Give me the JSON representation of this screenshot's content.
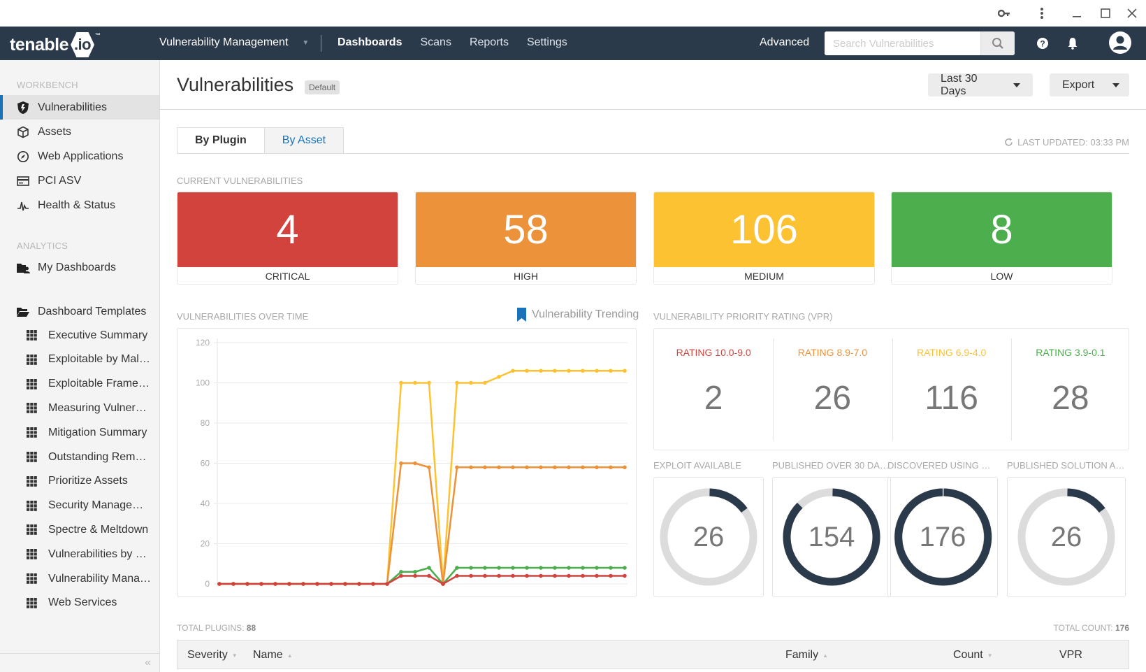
{
  "window": {
    "controls": [
      "key-icon",
      "more-icon",
      "minimize-icon",
      "maximize-icon",
      "close-icon"
    ]
  },
  "topnav": {
    "logo_text": "tenable",
    "logo_suffix": ".io",
    "logo_tm": "™",
    "product": "Vulnerability Management",
    "links": [
      {
        "label": "Dashboards",
        "active": true
      },
      {
        "label": "Scans",
        "active": false
      },
      {
        "label": "Reports",
        "active": false
      },
      {
        "label": "Settings",
        "active": false
      }
    ],
    "advanced": "Advanced",
    "search_placeholder": "Search Vulnerabilities",
    "search_value": ""
  },
  "sidebar": {
    "workbench_label": "WORKBENCH",
    "workbench_items": [
      {
        "label": "Vulnerabilities",
        "icon": "shield-icon",
        "active": true
      },
      {
        "label": "Assets",
        "icon": "cube-icon"
      },
      {
        "label": "Web Applications",
        "icon": "compass-icon"
      },
      {
        "label": "PCI ASV",
        "icon": "credit-card-icon"
      },
      {
        "label": "Health & Status",
        "icon": "pulse-icon"
      }
    ],
    "analytics_label": "ANALYTICS",
    "my_dashboards": "My Dashboards",
    "templates_label": "Dashboard Templates",
    "templates": [
      "Executive Summary",
      "Exploitable by Mal…",
      "Exploitable Frame…",
      "Measuring Vulner…",
      "Mitigation Summary",
      "Outstanding Rem…",
      "Prioritize Assets",
      "Security Manage…",
      "Spectre & Meltdown",
      "Vulnerabilities by …",
      "Vulnerability Mana…",
      "Web Services"
    ],
    "collapse": "«"
  },
  "header": {
    "title": "Vulnerabilities",
    "badge": "Default",
    "date_range": "Last 30 Days",
    "export": "Export"
  },
  "tabs": [
    {
      "label": "By Plugin",
      "active": true
    },
    {
      "label": "By Asset",
      "active": false
    }
  ],
  "last_updated": "LAST UPDATED: 03:33 PM",
  "current": {
    "label": "CURRENT VULNERABILITIES",
    "cards": [
      {
        "value": "4",
        "label": "CRITICAL",
        "color": "#d3433e"
      },
      {
        "value": "58",
        "label": "HIGH",
        "color": "#ec923a"
      },
      {
        "value": "106",
        "label": "MEDIUM",
        "color": "#fcc232"
      },
      {
        "value": "8",
        "label": "LOW",
        "color": "#4cae4c"
      }
    ]
  },
  "over_time": {
    "label": "VULNERABILITIES OVER TIME",
    "link": "Vulnerability Trending"
  },
  "chart_data": {
    "type": "line",
    "title": "VULNERABILITIES OVER TIME",
    "xlabel": "",
    "ylabel": "",
    "ylim": [
      0,
      120
    ],
    "yticks": [
      0,
      20,
      40,
      60,
      80,
      100,
      120
    ],
    "grid": true,
    "x": [
      1,
      2,
      3,
      4,
      5,
      6,
      7,
      8,
      9,
      10,
      11,
      12,
      13,
      14,
      15,
      16,
      17,
      18,
      19,
      20,
      21,
      22,
      23,
      24,
      25,
      26,
      27,
      28,
      29,
      30
    ],
    "series": [
      {
        "name": "Medium",
        "color": "#fcc232",
        "values": [
          0,
          0,
          0,
          0,
          0,
          0,
          0,
          0,
          0,
          0,
          0,
          0,
          0,
          100,
          100,
          100,
          0,
          100,
          100,
          100,
          103,
          106,
          106,
          106,
          106,
          106,
          106,
          106,
          106,
          106
        ]
      },
      {
        "name": "High",
        "color": "#ec923a",
        "values": [
          0,
          0,
          0,
          0,
          0,
          0,
          0,
          0,
          0,
          0,
          0,
          0,
          0,
          60,
          60,
          58,
          0,
          58,
          58,
          58,
          58,
          58,
          58,
          58,
          58,
          58,
          58,
          58,
          58,
          58
        ]
      },
      {
        "name": "Low",
        "color": "#4cae4c",
        "values": [
          0,
          0,
          0,
          0,
          0,
          0,
          0,
          0,
          0,
          0,
          0,
          0,
          0,
          6,
          6,
          8,
          0,
          8,
          8,
          8,
          8,
          8,
          8,
          8,
          8,
          8,
          8,
          8,
          8,
          8
        ]
      },
      {
        "name": "Critical",
        "color": "#d3433e",
        "values": [
          0,
          0,
          0,
          0,
          0,
          0,
          0,
          0,
          0,
          0,
          0,
          0,
          0,
          4,
          4,
          4,
          0,
          4,
          4,
          4,
          4,
          4,
          4,
          4,
          4,
          4,
          4,
          4,
          4,
          4
        ]
      }
    ]
  },
  "vpr": {
    "label": "VULNERABILITY PRIORITY RATING (VPR)",
    "ratings": [
      {
        "label": "RATING 10.0-9.0",
        "value": "2",
        "color": "#d3433e"
      },
      {
        "label": "RATING 8.9-7.0",
        "value": "26",
        "color": "#ec923a"
      },
      {
        "label": "RATING 6.9-4.0",
        "value": "116",
        "color": "#fcc232"
      },
      {
        "label": "RATING 3.9-0.1",
        "value": "28",
        "color": "#4cae4c"
      }
    ]
  },
  "donuts": [
    {
      "label": "EXPLOIT AVAILABLE",
      "value": "26",
      "fraction": 0.148
    },
    {
      "label": "PUBLISHED OVER 30 DA…",
      "value": "154",
      "fraction": 0.875
    },
    {
      "label": "DISCOVERED USING …",
      "value": "176",
      "fraction": 1.0
    },
    {
      "label": "PUBLISHED SOLUTION A…",
      "value": "26",
      "fraction": 0.148
    }
  ],
  "table": {
    "total_plugins_label": "TOTAL PLUGINS:",
    "total_plugins": "88",
    "total_count_label": "TOTAL COUNT:",
    "total_count": "176",
    "columns": [
      "Severity",
      "Name",
      "Family",
      "Count",
      "VPR"
    ]
  },
  "colors": {
    "nav_bg": "#2b3a4a",
    "accent": "#1a73b8",
    "donut_fill": "#2b3a4a",
    "donut_track": "#dcdcdc"
  }
}
